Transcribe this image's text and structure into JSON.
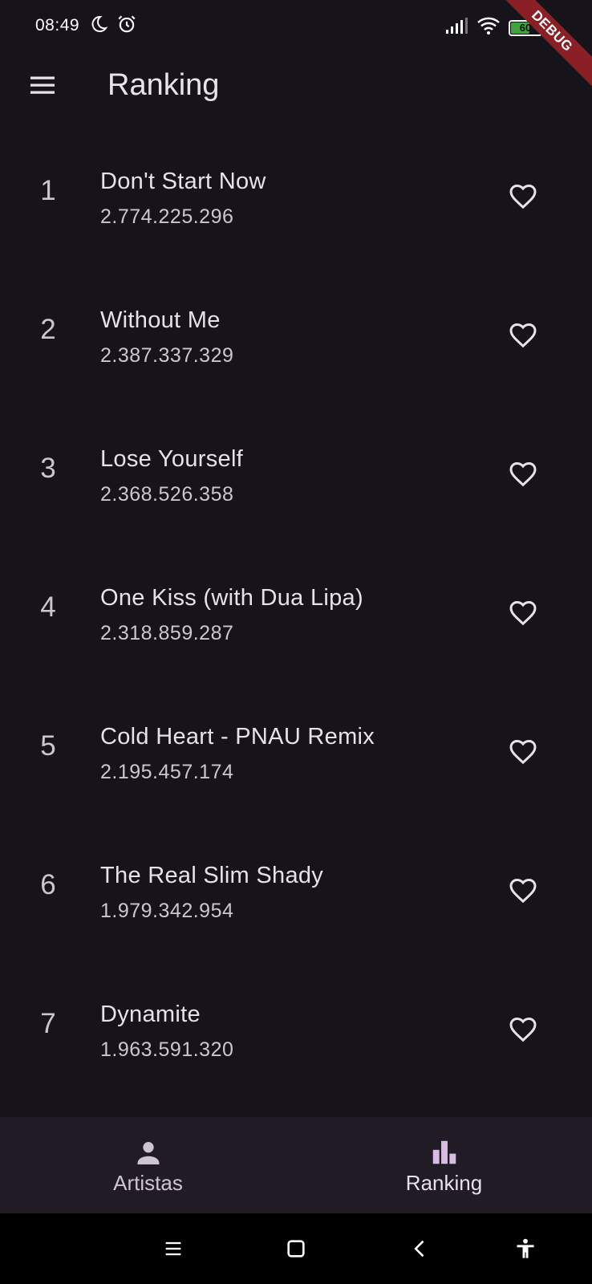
{
  "status_bar": {
    "time": "08:49",
    "battery_level": "60",
    "icons": [
      "moon-icon",
      "alarm-icon",
      "signal-icon",
      "wifi-icon",
      "battery-icon"
    ]
  },
  "debug_banner": "DEBUG",
  "app_bar": {
    "title": "Ranking",
    "menu_icon": "hamburger-menu-icon"
  },
  "songs": [
    {
      "rank": "1",
      "title": "Don't Start Now",
      "streams": "2.774.225.296"
    },
    {
      "rank": "2",
      "title": "Without Me",
      "streams": "2.387.337.329"
    },
    {
      "rank": "3",
      "title": "Lose Yourself",
      "streams": "2.368.526.358"
    },
    {
      "rank": "4",
      "title": "One Kiss (with Dua Lipa)",
      "streams": "2.318.859.287"
    },
    {
      "rank": "5",
      "title": "Cold Heart - PNAU Remix",
      "streams": "2.195.457.174"
    },
    {
      "rank": "6",
      "title": "The Real Slim Shady",
      "streams": "1.979.342.954"
    },
    {
      "rank": "7",
      "title": "Dynamite",
      "streams": "1.963.591.320"
    }
  ],
  "bottom_nav": {
    "items": [
      {
        "label": "Artistas",
        "icon": "person-icon",
        "active": false
      },
      {
        "label": "Ranking",
        "icon": "bar-chart-icon",
        "active": true
      }
    ]
  },
  "system_nav": [
    "recents-icon",
    "home-icon",
    "back-icon",
    "accessibility-icon"
  ],
  "colors": {
    "background": "#17131b",
    "text": "#e8e0ea",
    "accent": "#d7bde4",
    "nav_background": "#201b24",
    "debug_ribbon": "#8b1f26"
  }
}
